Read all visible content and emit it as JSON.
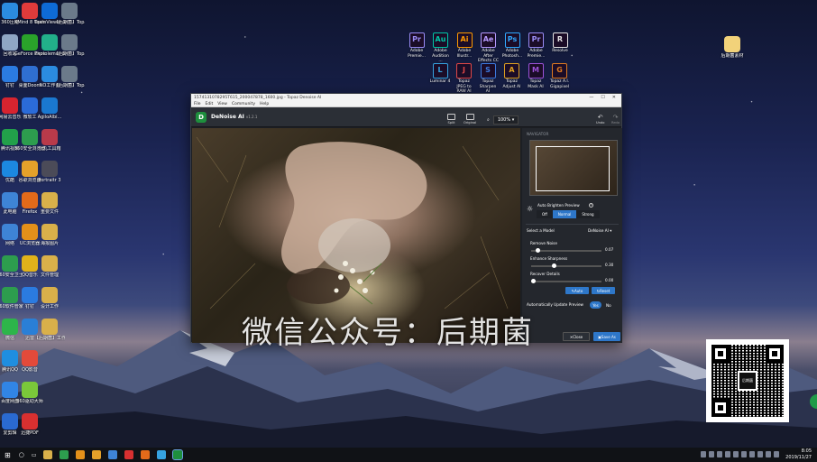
{
  "desktop": {
    "left_icons": [
      {
        "label": "360压缩",
        "color": "#2b8be0"
      },
      {
        "label": "XMind 8 Update 7",
        "color": "#e03b3b"
      },
      {
        "label": "TeamViewer 14",
        "color": "#0e6bd6"
      },
      {
        "label": "【后期菌】Topaz AI...",
        "color": "#6b7a8a"
      },
      {
        "label": "回收站",
        "color": "#8fa6c4"
      },
      {
        "label": "GeForce Experience",
        "color": "#2aa32a"
      },
      {
        "label": "Photolemur 3",
        "color": "#22b08a"
      },
      {
        "label": "【后期菌】Topaz AI...",
        "color": "#6b7a8a"
      },
      {
        "label": "钉钉",
        "color": "#2b7be0"
      },
      {
        "label": "桌面Doom",
        "color": "#2f6fd1"
      },
      {
        "label": "NO工作台",
        "color": "#2b8be0"
      },
      {
        "label": "【后期菌】Topaz AI...",
        "color": "#6b7a8a"
      },
      {
        "label": "网易云音乐",
        "color": "#d7242f"
      },
      {
        "label": "微软工",
        "color": "#2b6bd8"
      },
      {
        "label": "AgiloAlbi...",
        "color": "#1a78d0"
      },
      {
        "label": "腾讯视频",
        "color": "#22a04a"
      },
      {
        "label": "360安全浏览器",
        "color": "#2d9d4e"
      },
      {
        "label": "小丸工具箱",
        "color": "#b83a4a"
      },
      {
        "label": "优酷",
        "color": "#1c88e0"
      },
      {
        "label": "谷歌浏览器",
        "color": "#e4a12a"
      },
      {
        "label": "Portraitr 3",
        "color": "#4b4b58"
      },
      {
        "label": "此电脑",
        "color": "#3e84d6"
      },
      {
        "label": "Firefox",
        "color": "#e36a1a"
      },
      {
        "label": "重要文件",
        "color": "#d9b04a"
      },
      {
        "label": "网络",
        "color": "#3e84d6"
      },
      {
        "label": "UC浏览器",
        "color": "#e3901a"
      },
      {
        "label": "海报图片",
        "color": "#d9b04a"
      },
      {
        "label": "360安全卫士",
        "color": "#2d9d4e"
      },
      {
        "label": "QQ音乐",
        "color": "#e0b21a"
      },
      {
        "label": "文件管理",
        "color": "#d9b04a"
      },
      {
        "label": "360软件管家",
        "color": "#2d9d4e"
      },
      {
        "label": "钉钉",
        "color": "#2b7be0"
      },
      {
        "label": "设计工作",
        "color": "#d9b04a"
      },
      {
        "label": "微信",
        "color": "#2db54a"
      },
      {
        "label": "迅雷",
        "color": "#2a7fd6"
      },
      {
        "label": "【后期菌】工作室",
        "color": "#d9b04a"
      },
      {
        "label": "腾讯QQ",
        "color": "#1f8ee0"
      },
      {
        "label": "QQ影音",
        "color": "#e34a3a"
      },
      {
        "label": "百度网盘",
        "color": "#3185e6"
      },
      {
        "label": "360驱动大师",
        "color": "#7ac83a"
      },
      {
        "label": "爱剪辑",
        "color": "#2a6ad0"
      },
      {
        "label": "迅捷PDF",
        "color": "#d83030"
      }
    ],
    "adobe_icons": [
      {
        "label": "Adobe Premie...",
        "abbr": "Pr",
        "color": "#9a8cf5"
      },
      {
        "label": "Adobe Audition ...",
        "abbr": "Au",
        "color": "#00c8a8"
      },
      {
        "label": "Adobe Illustr...",
        "abbr": "Ai",
        "color": "#ff9a00"
      },
      {
        "label": "Adobe After Effects CC ...",
        "abbr": "Ae",
        "color": "#b69aff"
      },
      {
        "label": "Adobe Photosh...",
        "abbr": "Ps",
        "color": "#31a8ff"
      },
      {
        "label": "Adobe Premie...",
        "abbr": "Pr",
        "color": "#9a8cf5"
      },
      {
        "label": "Resolve",
        "abbr": "R",
        "color": "#e6e6e6"
      }
    ],
    "topaz_icons": [
      {
        "label": "Luminar 4",
        "abbr": "L",
        "color": "#36a3e0"
      },
      {
        "label": "Topaz JPEG to RAW AI",
        "abbr": "J",
        "color": "#e04646"
      },
      {
        "label": "Topaz Sharpen AI",
        "abbr": "S",
        "color": "#3d7ae0"
      },
      {
        "label": "Topaz Adjust AI",
        "abbr": "A",
        "color": "#e0a020"
      },
      {
        "label": "Topaz Mask AI",
        "abbr": "M",
        "color": "#9c52d8"
      },
      {
        "label": "Topaz A.I. Gigapixel",
        "abbr": "G",
        "color": "#e07a20"
      }
    ],
    "right_icon": {
      "label": "后期菌素材"
    }
  },
  "window": {
    "title": "1574131078295T615_200047878_1600.jpg - Topaz Denoise AI",
    "controls": [
      "—",
      "☐",
      "✕"
    ],
    "menu": [
      "File",
      "Edit",
      "View",
      "Community",
      "Help"
    ],
    "app_name": "DeNoise AI",
    "version": "v1.2.1",
    "tools": [
      {
        "label": "Split"
      },
      {
        "label": "Original"
      }
    ],
    "zoom": "100%",
    "undo": "Undo",
    "redo": "Redo"
  },
  "panel": {
    "navigator": "NAVIGATOR",
    "auto_brighten": "Auto Brighten Preview",
    "brighten_options": [
      "Off",
      "Normal",
      "Strong"
    ],
    "brighten_selected": 1,
    "select_model": "Select a Model",
    "model": "DeNoise AI",
    "sliders": [
      {
        "label": "Remove Noise",
        "value": "0.07",
        "level": 0.07
      },
      {
        "label": "Enhance Sharpness",
        "value": "0.30",
        "level": 0.3
      },
      {
        "label": "Recover Details",
        "value": "0.00",
        "level": 0.0
      }
    ],
    "auto_label": "Auto",
    "reset_label": "Reset",
    "auto_update": "Automatically Update Preview",
    "yes": "Yes",
    "no": "No",
    "close": "Close",
    "save": "Save As"
  },
  "watermark": "微信公众号：后期菌",
  "qr_center": "后期菌",
  "clock": {
    "time": "8:05",
    "date": "2019/11/27"
  }
}
